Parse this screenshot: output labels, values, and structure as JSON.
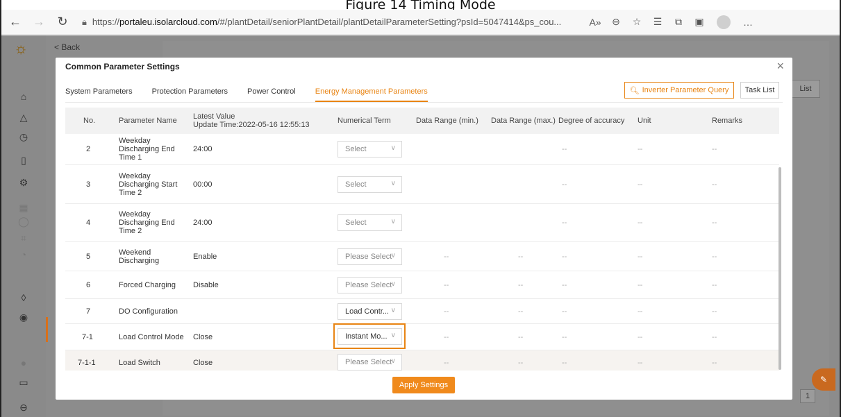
{
  "caption": "Figure 14 Timing Mode",
  "browser": {
    "url_prefix": "https://",
    "url_host": "portaleu.isolarcloud.com",
    "url_path": "/#/plantDetail/seniorPlantDetail/plantDetailParameterSetting?psId=5047414&ps_cou...",
    "icons": [
      "back-icon",
      "forward-icon",
      "refresh-icon",
      "lock-icon",
      "read-aloud-icon",
      "zoom-icon",
      "favorite-add-icon",
      "favorites-icon",
      "collections-icon",
      "extensions-icon",
      "profile-icon",
      "more-icon"
    ]
  },
  "app": {
    "back_label": "< Back",
    "bg_task_list": "List",
    "bg_page": "1"
  },
  "modal": {
    "title": "Common Parameter Settings",
    "close": "×",
    "tabs": [
      {
        "label": "System Parameters",
        "active": false
      },
      {
        "label": "Protection Parameters",
        "active": false
      },
      {
        "label": "Power Control",
        "active": false
      },
      {
        "label": "Energy Management Parameters",
        "active": true
      }
    ],
    "query_button": "Inverter Parameter Query",
    "task_list_button": "Task List",
    "apply_button": "Apply Settings"
  },
  "table": {
    "headers": {
      "no": "No.",
      "name": "Parameter Name",
      "latest": "Latest Value",
      "update_time": "Update Time:2022-05-16 12:55:13",
      "term": "Numerical Term",
      "min": "Data Range (min.)",
      "max": "Data Range (max.)",
      "accuracy": "Degree of accuracy",
      "unit": "Unit",
      "remarks": "Remarks"
    },
    "rows": [
      {
        "no": "2",
        "name": [
          "Weekday",
          "Discharging End",
          "Time 1"
        ],
        "value": "24:00",
        "term": "Select",
        "min": "",
        "max": "",
        "acc": "--",
        "unit": "--",
        "remarks": "--"
      },
      {
        "no": "3",
        "name": [
          "Weekday",
          "Discharging Start",
          "Time 2"
        ],
        "value": "00:00",
        "term": "Select",
        "min": "",
        "max": "",
        "acc": "--",
        "unit": "--",
        "remarks": "--"
      },
      {
        "no": "4",
        "name": [
          "Weekday",
          "Discharging End",
          "Time 2"
        ],
        "value": "24:00",
        "term": "Select",
        "min": "",
        "max": "",
        "acc": "--",
        "unit": "--",
        "remarks": "--"
      },
      {
        "no": "5",
        "name": [
          "Weekend",
          "Discharging"
        ],
        "value": "Enable",
        "term": "Please Select",
        "min": "--",
        "max": "--",
        "acc": "--",
        "unit": "--",
        "remarks": "--"
      },
      {
        "no": "6",
        "name": [
          "Forced Charging"
        ],
        "value": "Disable",
        "term": "Please Select",
        "min": "--",
        "max": "--",
        "acc": "--",
        "unit": "--",
        "remarks": "--"
      },
      {
        "no": "7",
        "name": [
          "DO Configuration"
        ],
        "value": "",
        "term": "Load Contr...",
        "min": "--",
        "max": "--",
        "acc": "--",
        "unit": "--",
        "remarks": "--"
      },
      {
        "no": "7-1",
        "name": [
          "Load Control Mode"
        ],
        "value": "Close",
        "term": "Instant Mo...",
        "min": "--",
        "max": "--",
        "acc": "--",
        "unit": "--",
        "remarks": "--"
      },
      {
        "no": "7-1-1",
        "name": [
          "Load Switch"
        ],
        "value": "Close",
        "term": "Please Select",
        "min": "--",
        "max": "--",
        "acc": "--",
        "unit": "--",
        "remarks": "--"
      }
    ]
  },
  "colors": {
    "accent": "#e88413",
    "apply_bg": "#f08a1c"
  }
}
